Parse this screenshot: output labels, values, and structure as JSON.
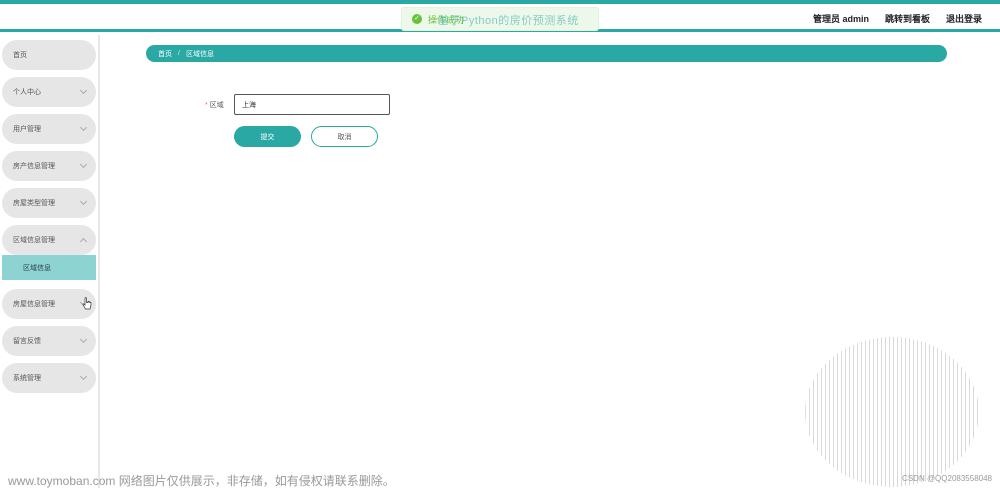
{
  "header": {
    "app_title": "基于Python的房价预测系统",
    "toast_text": "操作成功",
    "user_label": "管理员 admin",
    "board_link": "跳转到看板",
    "logout_link": "退出登录"
  },
  "sidebar": {
    "items": [
      {
        "label": "首页"
      },
      {
        "label": "个人中心"
      },
      {
        "label": "用户管理"
      },
      {
        "label": "房产信息管理"
      },
      {
        "label": "房屋类型管理"
      },
      {
        "label": "区域信息管理"
      },
      {
        "label": "房屋信息管理"
      },
      {
        "label": "留言反馈"
      },
      {
        "label": "系统管理"
      }
    ],
    "active_sub": "区域信息"
  },
  "breadcrumb": {
    "home": "首页",
    "separator": "/",
    "current": "区域信息"
  },
  "form": {
    "region_label": "区域",
    "required_mark": "*",
    "region_value": "上海",
    "submit_label": "提交",
    "cancel_label": "取消"
  },
  "footer": {
    "watermark": "www.toymoban.com 网络图片仅供展示，非存储，如有侵权请联系删除。",
    "csdn": "CSDN @QQ2083558048"
  },
  "colors": {
    "accent": "#2aa8a3",
    "submenu_active": "#8dd3d1",
    "menu_bg": "#e6e6e6",
    "required": "#f56c6c",
    "success": "#67c23a"
  }
}
